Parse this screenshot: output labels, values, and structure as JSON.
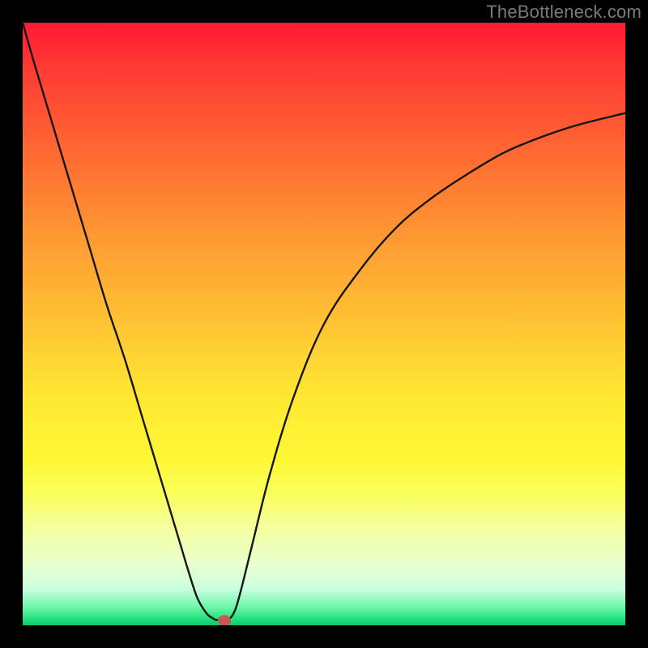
{
  "watermark": "TheBottleneck.com",
  "colors": {
    "page_bg": "#000000",
    "watermark": "#7a7a7a",
    "curve_stroke": "#151515",
    "marker_fill": "#c65a50"
  },
  "chart_data": {
    "type": "line",
    "title": "",
    "xlabel": "",
    "ylabel": "",
    "xlim": [
      0,
      100
    ],
    "ylim": [
      0,
      100
    ],
    "grid": false,
    "legend": false,
    "background": "vertical-gradient-red-to-green",
    "x": [
      0,
      2,
      5,
      8,
      11,
      14,
      17,
      20,
      23,
      26,
      27.5,
      29,
      30.5,
      31.5,
      32.2,
      34,
      35,
      36,
      38,
      41,
      45,
      50,
      56,
      62,
      68,
      74,
      80,
      86,
      92,
      100
    ],
    "y": [
      100,
      93,
      83,
      73,
      63,
      53,
      44,
      34,
      24,
      14,
      9,
      4.5,
      2.0,
      1.2,
      0.9,
      1.0,
      2.0,
      5,
      13,
      25,
      38,
      50,
      59,
      66,
      71,
      75,
      78.5,
      81,
      83,
      85
    ],
    "marker": {
      "x": 33.5,
      "y": 0.8
    },
    "notes": "Values are percentages of the plot area (0=left/bottom, 100=right/top). Curve is a V/check-shaped bottleneck plot with minimum near x≈33."
  }
}
